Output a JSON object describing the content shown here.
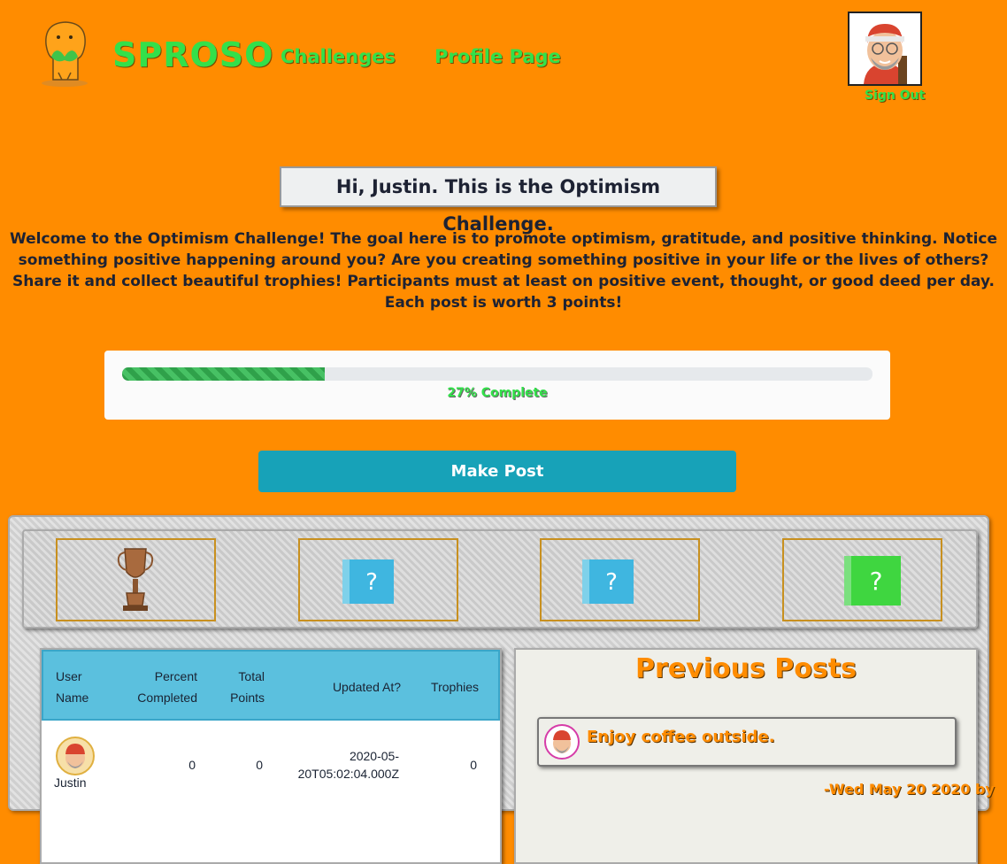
{
  "header": {
    "brand": "SPROSO",
    "nav": {
      "challenges": "Challenges",
      "profile": "Profile Page"
    },
    "sign_out": "Sign Out"
  },
  "greeting": "Hi, Justin. This is the Optimism Challenge.",
  "description": "Welcome to the Optimism Challenge! The goal here is to promote optimism, gratitude, and positive thinking. Notice something positive happening around you? Are you creating something positive in your life or the lives of others? Share it and collect beautiful trophies! Participants must at least on positive event, thought, or good deed per day. Each post is worth 3 points!",
  "progress": {
    "percent": 27,
    "label": "27% Complete"
  },
  "make_post_label": "Make Post",
  "trophies": [
    {
      "icon": "bronze-trophy-icon"
    },
    {
      "icon": "mystery-box-icon",
      "mark": "?"
    },
    {
      "icon": "mystery-box-icon",
      "mark": "?"
    },
    {
      "icon": "mystery-box-icon",
      "mark": "?"
    }
  ],
  "table": {
    "headers": {
      "user_line1": "User",
      "user_line2": "Name",
      "percent_line1": "Percent",
      "percent_line2": "Completed",
      "points_line1": "Total",
      "points_line2": "Points",
      "updated": "Updated At?",
      "trophies": "Trophies"
    },
    "rows": [
      {
        "name": "Justin",
        "percent": "0",
        "points": "0",
        "updated_line1": "2020-05-",
        "updated_line2": "20T05:02:04.000Z",
        "trophies": "0"
      }
    ]
  },
  "posts": {
    "title": "Previous Posts",
    "items": [
      {
        "text": "Enjoy coffee outside.",
        "date": "-Wed May 20 2020 by"
      }
    ]
  },
  "colors": {
    "background": "#ff8c00",
    "brand_green": "#33e04a",
    "button": "#17a2b8",
    "table_header": "#5bc0de"
  }
}
